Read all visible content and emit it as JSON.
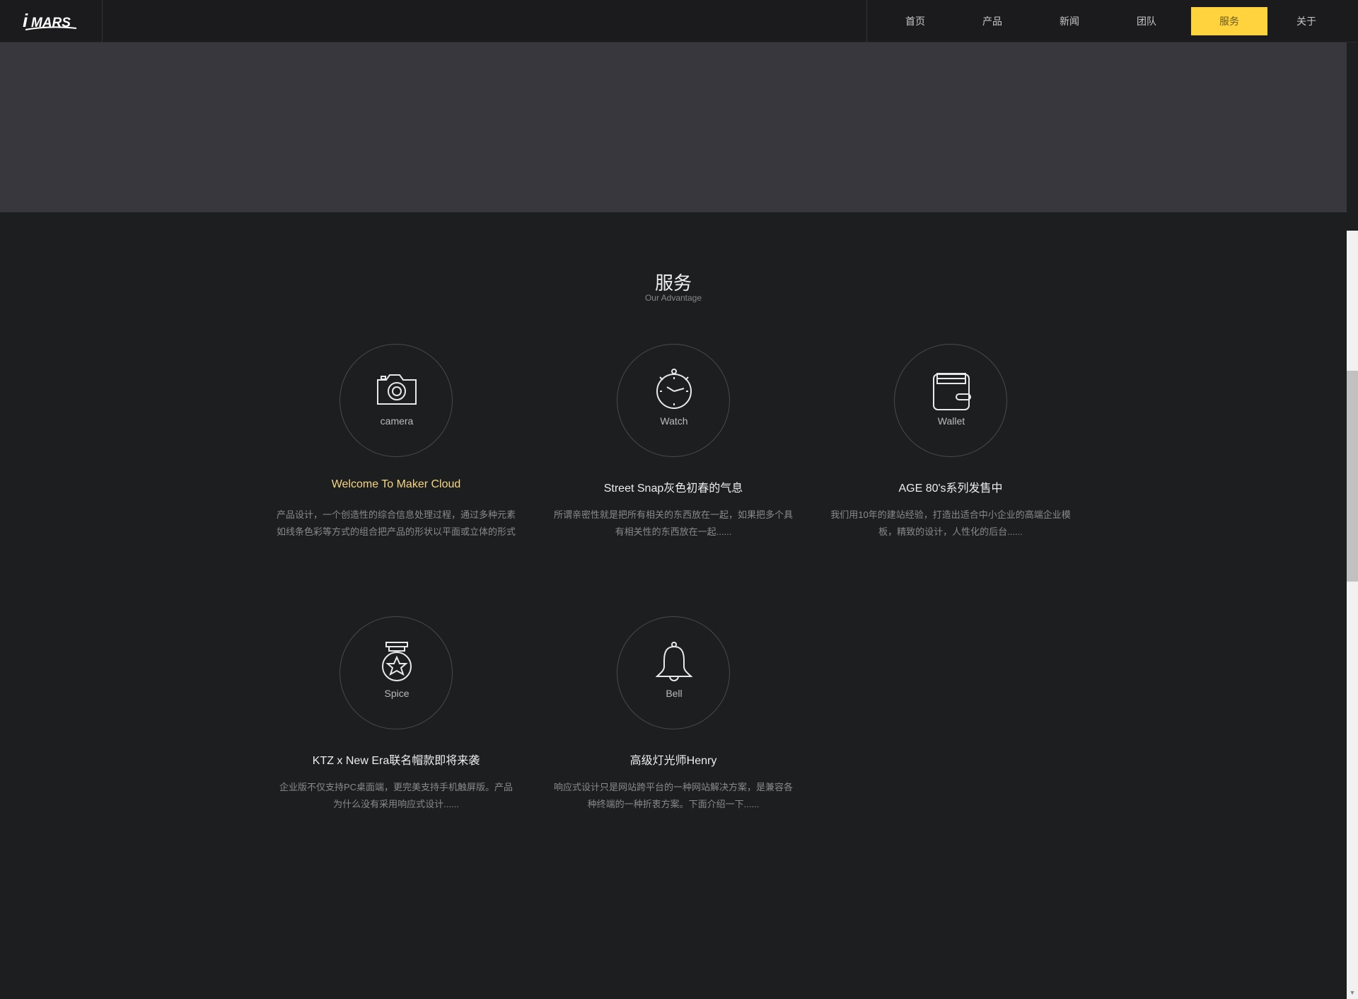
{
  "brand": {
    "logo_text": "iMARS"
  },
  "nav": {
    "items": [
      {
        "label": "首页"
      },
      {
        "label": "产品"
      },
      {
        "label": "新闻"
      },
      {
        "label": "团队"
      },
      {
        "label": "服务",
        "active": true
      },
      {
        "label": "关于"
      }
    ]
  },
  "section": {
    "title": "服务",
    "subtitle": "Our Advantage"
  },
  "services": [
    {
      "icon": "camera-icon",
      "icon_label": "camera",
      "title": "Welcome To Maker Cloud",
      "desc": "产品设计，一个创造性的综合信息处理过程，通过多种元素如线条色彩等方式的组合把产品的形状以平面或立体的形式"
    },
    {
      "icon": "stopwatch-icon",
      "icon_label": "Watch",
      "title": "Street Snap灰色初春的气息",
      "desc": "所谓亲密性就是把所有相关的东西放在一起，如果把多个具有相关性的东西放在一起......"
    },
    {
      "icon": "wallet-icon",
      "icon_label": "Wallet",
      "title": "AGE 80's系列发售中",
      "desc": "我们用10年的建站经验，打造出适合中小企业的高端企业模板，精致的设计，人性化的后台......"
    },
    {
      "icon": "medal-icon",
      "icon_label": "Spice",
      "title": "KTZ x New Era联名帽款即将来袭",
      "desc": "企业版不仅支持PC桌面端，更完美支持手机触屏版。产品为什么没有采用响应式设计......"
    },
    {
      "icon": "bell-icon",
      "icon_label": "Bell",
      "title": "高级灯光师Henry",
      "desc": "响应式设计只是网站跨平台的一种网站解决方案，是兼容各种终端的一种折衷方案。下面介绍一下......"
    }
  ],
  "colors": {
    "accent": "#ffd33e",
    "header_bg": "#1b1b1d",
    "banner_bg": "#38373d",
    "page_bg": "#1d1e20",
    "highlight_title": "#f7d680"
  }
}
